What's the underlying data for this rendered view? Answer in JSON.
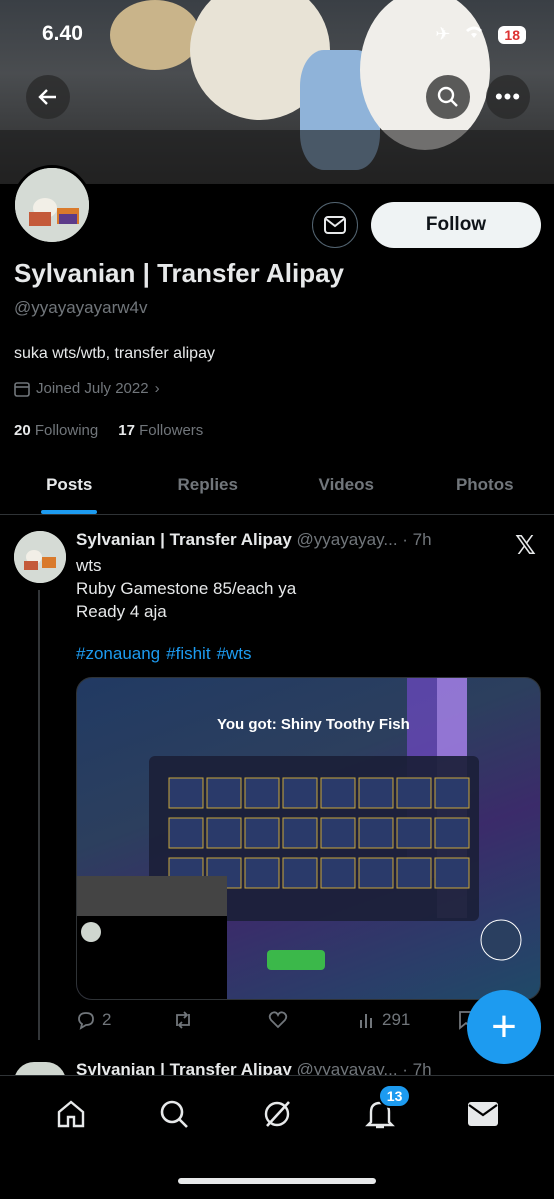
{
  "status_bar": {
    "time": "6.40",
    "battery": "18"
  },
  "profile": {
    "name": "Sylvanian | Transfer Alipay",
    "handle": "@yyayayayarw4v",
    "bio": "suka wts/wtb, transfer alipay",
    "joined": "Joined July 2022",
    "following_count": "20",
    "following_label": "Following",
    "followers_count": "17",
    "followers_label": "Followers",
    "follow_label": "Follow"
  },
  "tabs": [
    {
      "label": "Posts"
    },
    {
      "label": "Replies"
    },
    {
      "label": "Videos"
    },
    {
      "label": "Photos"
    }
  ],
  "post": {
    "author": "Sylvanian | Transfer Alipay",
    "handle_time": "@yyayayay... · 7h",
    "text": "wts\nRuby Gamestone 85/each ya\nReady 4 aja",
    "hashtags": [
      "#zonauang",
      "#fishit",
      "#wts"
    ],
    "media_caption": "You got: Shiny Toothy Fish",
    "replies": "2",
    "views": "291"
  },
  "post2": {
    "author": "Sylvanian | Transfer Alipay",
    "handle_time": "@yyayayay... · 7h"
  },
  "nav": {
    "notifications_badge": "13"
  },
  "colors": {
    "accent": "#1d9bf0",
    "background": "#000000",
    "muted": "#71767b"
  }
}
